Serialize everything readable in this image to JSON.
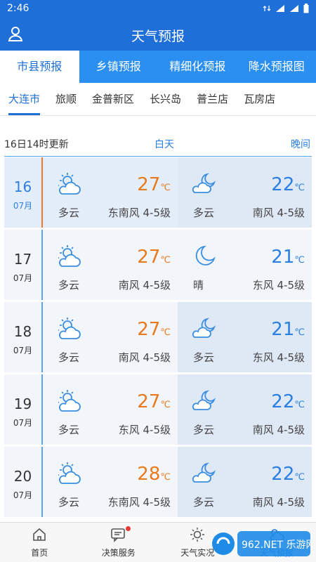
{
  "status": {
    "time": "2:46"
  },
  "header": {
    "title": "天气预报"
  },
  "tabs": [
    {
      "label": "市县预报",
      "active": true
    },
    {
      "label": "乡镇预报"
    },
    {
      "label": "精细化预报"
    },
    {
      "label": "降水预报图"
    }
  ],
  "cities": [
    "大连市",
    "旅顺",
    "金普新区",
    "长兴岛",
    "普兰店",
    "瓦房店"
  ],
  "table": {
    "updated": "16日14时更新",
    "day_label": "白天",
    "night_label": "晚间"
  },
  "temp_unit": "℃",
  "forecast": [
    {
      "day": "16",
      "month": "07月",
      "day_icon": "partly-cloudy-day-icon",
      "day_temp": "27",
      "day_cond": "多云",
      "day_wind": "东南风  4-5级",
      "night_icon": "partly-cloudy-night-icon",
      "night_temp": "22",
      "night_cond": "多云",
      "night_wind": "南风  4-5级"
    },
    {
      "day": "17",
      "month": "07月",
      "day_icon": "partly-cloudy-day-icon",
      "day_temp": "27",
      "day_cond": "多云",
      "day_wind": "南风  4-5级",
      "night_icon": "moon-icon",
      "night_temp": "21",
      "night_cond": "晴",
      "night_wind": "东风  4-5级"
    },
    {
      "day": "18",
      "month": "07月",
      "day_icon": "partly-cloudy-day-icon",
      "day_temp": "27",
      "day_cond": "多云",
      "day_wind": "南风  4-5级",
      "night_icon": "partly-cloudy-night-icon",
      "night_temp": "21",
      "night_cond": "多云",
      "night_wind": "东风  4-5级"
    },
    {
      "day": "19",
      "month": "07月",
      "day_icon": "partly-cloudy-day-icon",
      "day_temp": "27",
      "day_cond": "多云",
      "day_wind": "东风  4-5级",
      "night_icon": "partly-cloudy-night-icon",
      "night_temp": "22",
      "night_cond": "多云",
      "night_wind": "南风  4-5级"
    },
    {
      "day": "20",
      "month": "07月",
      "day_icon": "partly-cloudy-day-icon",
      "day_temp": "28",
      "day_cond": "多云",
      "day_wind": "东南风  4-5级",
      "night_icon": "partly-cloudy-night-icon",
      "night_temp": "22",
      "night_cond": "多云",
      "night_wind": "南风  4-5级"
    }
  ],
  "bottom_nav": [
    {
      "label": "首页",
      "icon": "home-icon"
    },
    {
      "label": "决策服务",
      "icon": "message-icon"
    },
    {
      "label": "天气实况",
      "icon": "sun-icon"
    },
    {
      "label": "天气预报",
      "icon": "forecast-icon",
      "active": true
    }
  ],
  "watermark": "962.NET 乐游网",
  "colors": {
    "primary": "#1e6fd8",
    "tab_bar": "#2a8ff0",
    "day_temp": "#e87a1e",
    "night_temp": "#2a7fe0"
  }
}
